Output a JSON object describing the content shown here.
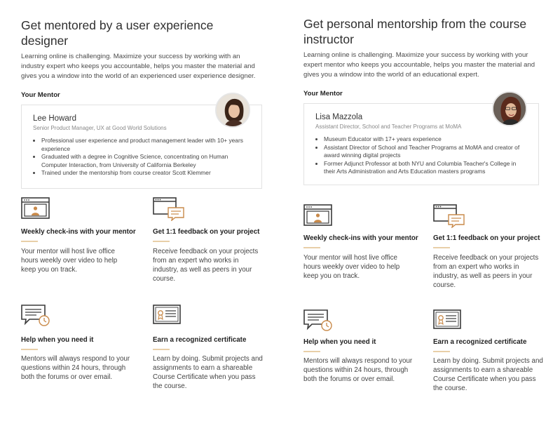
{
  "left": {
    "title": "Get mentored by a user experience designer",
    "intro": "Learning online is challenging. Maximize your success by working with an industry expert who keeps you accountable, helps you master the material and gives you a window into the world of an experienced user experience designer.",
    "your_mentor_label": "Your Mentor",
    "mentor": {
      "name": "Lee Howard",
      "role": "Senior Product Manager, UX at Good World Solutions",
      "bullets": [
        "Professional user experience and product management leader with 10+ years experience",
        "Graduated with a degree in Cognitive Science, concentrating on Human Computer Interaction, from University of California Berkeley",
        "Trained under the mentorship from course creator Scott Klemmer"
      ]
    },
    "features": [
      {
        "icon": "video-window-icon",
        "title": "Weekly check-ins with your mentor",
        "desc": "Your mentor will host live office hours weekly over video to help keep you on track."
      },
      {
        "icon": "feedback-window-icon",
        "title": "Get 1:1 feedback on your project",
        "desc": "Receive feedback on your projects from an expert who works in industry, as well as peers in your course."
      },
      {
        "icon": "chat-clock-icon",
        "title": "Help when you need it",
        "desc": "Mentors will always respond to your questions within 24 hours, through both the forums or over email."
      },
      {
        "icon": "certificate-icon",
        "title": "Earn a recognized certificate",
        "desc": "Learn by doing. Submit projects and assignments to earn a shareable Course Certificate when you pass the course."
      }
    ]
  },
  "right": {
    "title": "Get personal mentorship from the course instructor",
    "intro": "Learning online is challenging. Maximize your success by working with your expert mentor who keeps you accountable, helps you master the material and gives you a window into the world of an educational expert.",
    "your_mentor_label": "Your Mentor",
    "mentor": {
      "name": "Lisa Mazzola",
      "role": "Assistant Director, School and Teacher Programs at MoMA",
      "bullets": [
        "Museum Educator with 17+ years experience",
        "Assistant Director of School and Teacher Programs at MoMA and creator of award winning digital projects",
        "Former Adjunct Professor at both NYU and Columbia Teacher's College in their Arts Administration and Arts Education masters programs"
      ]
    },
    "features": [
      {
        "icon": "video-window-icon",
        "title": "Weekly check-ins with your mentor",
        "desc": "Your mentor will host live office hours weekly over video to help keep you on track."
      },
      {
        "icon": "feedback-window-icon",
        "title": "Get 1:1 feedback on your project",
        "desc": "Receive feedback on your projects from an expert who works in industry, as well as peers in your course."
      },
      {
        "icon": "chat-clock-icon",
        "title": "Help when you need it",
        "desc": "Mentors will always respond to your questions within 24 hours, through both the forums or over email."
      },
      {
        "icon": "certificate-icon",
        "title": "Earn a recognized certificate",
        "desc": "Learn by doing. Submit projects and assignments to earn a shareable Course Certificate when you pass the course."
      }
    ]
  },
  "colors": {
    "accent_rule": "#e8cfa8",
    "icon_stroke": "#3a3a3a",
    "icon_accent": "#c98a4a"
  }
}
